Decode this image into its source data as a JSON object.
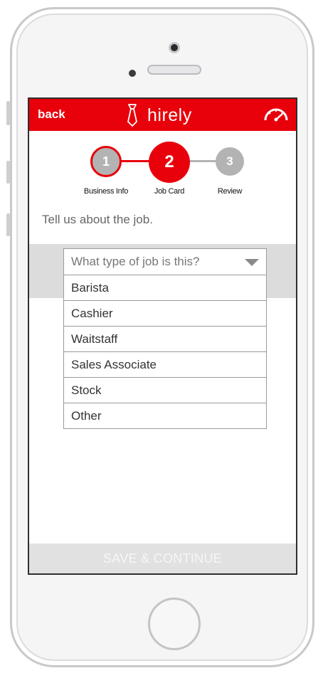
{
  "app": {
    "name": "hirely"
  },
  "topbar": {
    "back_label": "back"
  },
  "steps": [
    {
      "number": "1",
      "label": "Business Info",
      "state": "completed"
    },
    {
      "number": "2",
      "label": "Job Card",
      "state": "active"
    },
    {
      "number": "3",
      "label": "Review",
      "state": "pending"
    }
  ],
  "main": {
    "prompt": "Tell us about the job.",
    "job_type": {
      "placeholder": "What type of job is this?",
      "options": [
        "Barista",
        "Cashier",
        "Waitstaff",
        "Sales Associate",
        "Stock",
        "Other"
      ]
    }
  },
  "footer": {
    "save_label": "SAVE & CONTINUE"
  },
  "colors": {
    "brand_red": "#e8000b",
    "step_gray": "#b3b3b3",
    "band_gray": "#dcdcdc"
  },
  "icons": {
    "logo": "tie-icon",
    "dashboard": "speedometer-icon",
    "dropdown": "chevron-down-icon"
  }
}
